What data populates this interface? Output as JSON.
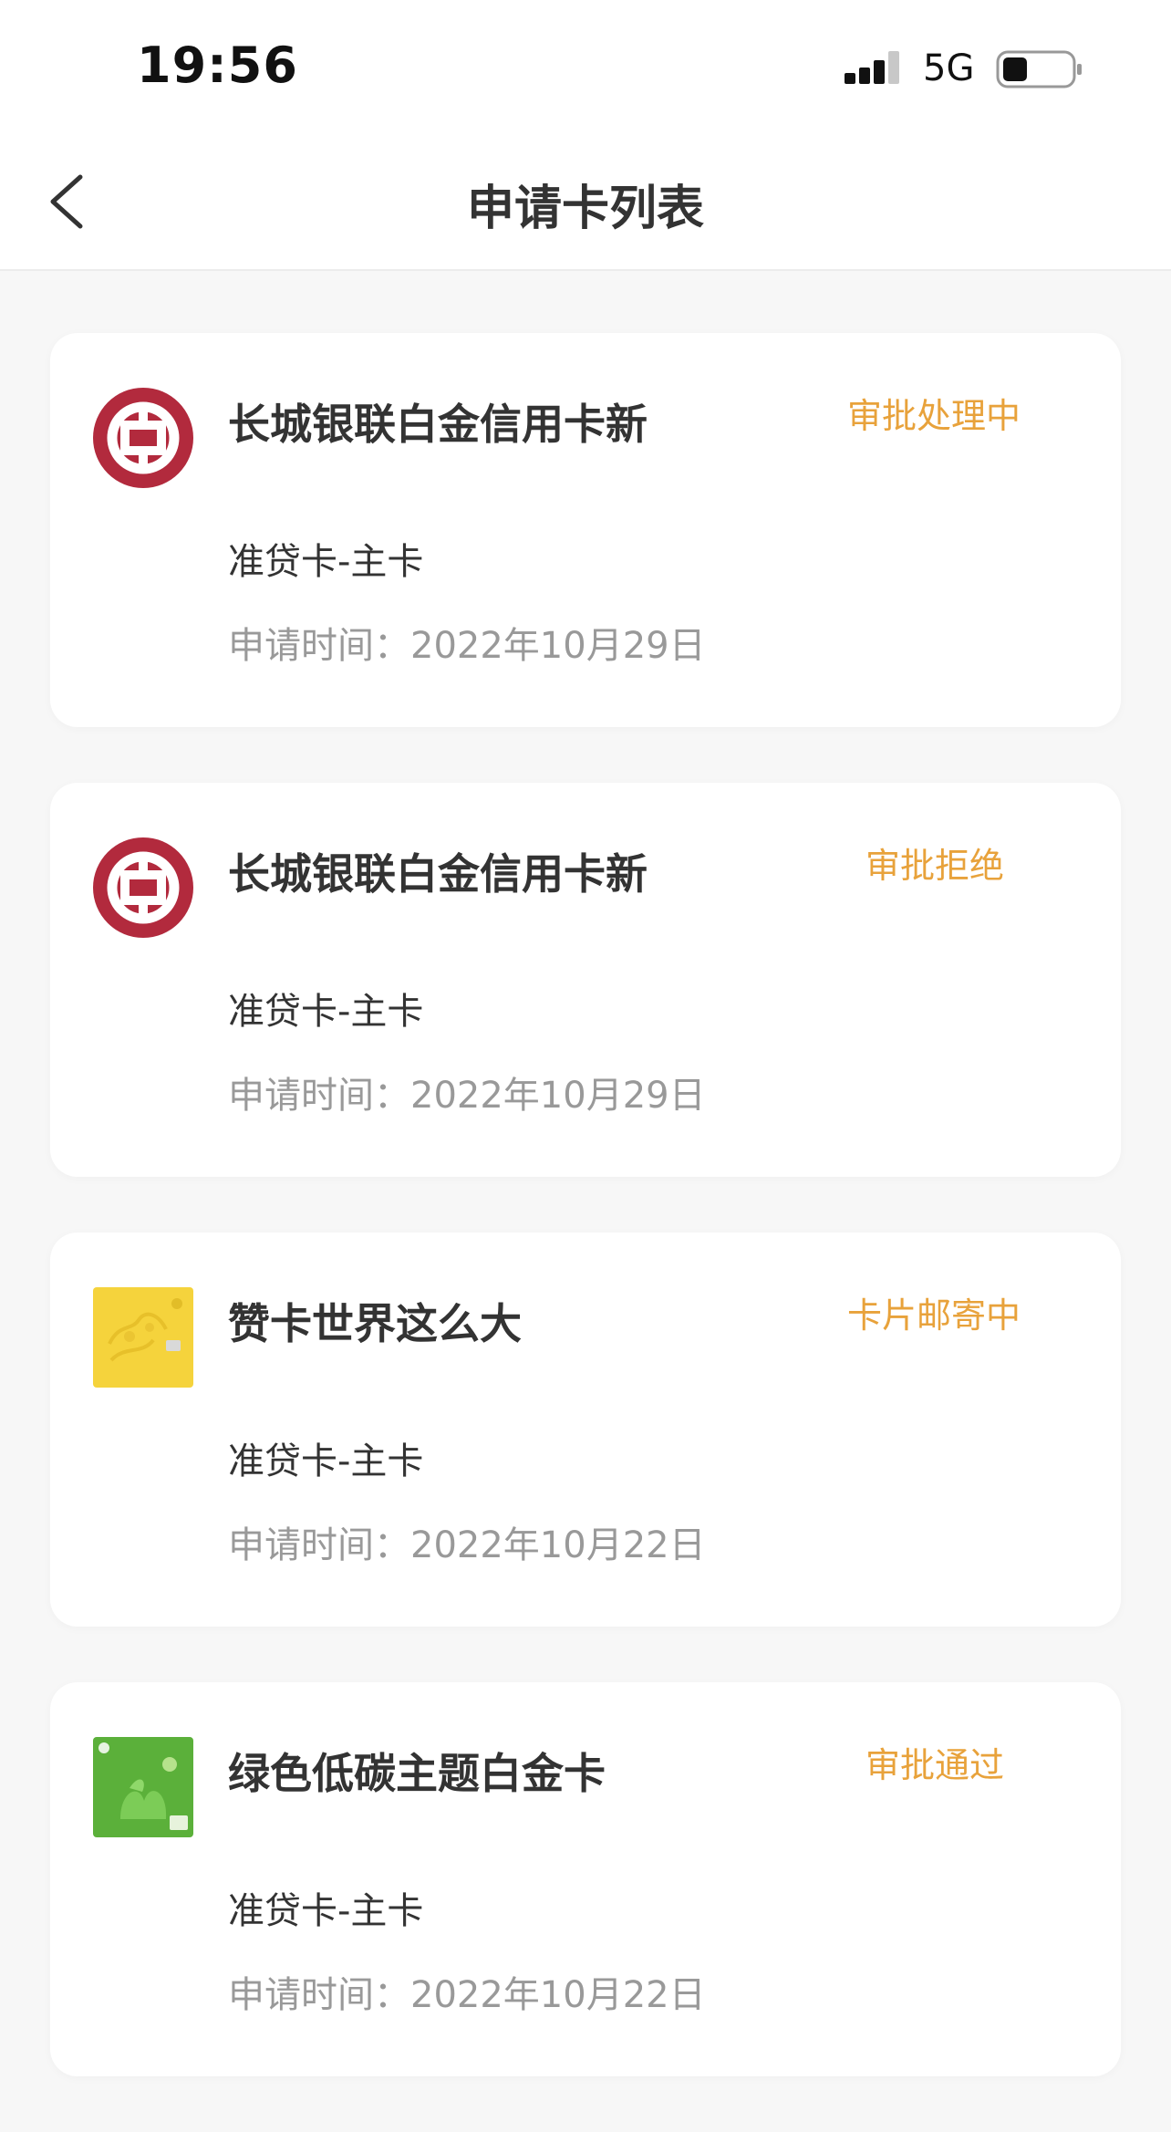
{
  "status_bar": {
    "time": "19:56",
    "network": "5G"
  },
  "nav": {
    "title": "申请卡列表"
  },
  "colors": {
    "status_accent": "#e8a23b",
    "boc_red": "#b22a3d",
    "yellow_card": "#f5d33c",
    "green_card": "#5bb03a"
  },
  "cards": [
    {
      "title": "长城银联白金信用卡新",
      "status": "审批处理中",
      "type": "准贷卡-主卡",
      "date_label": "申请时间：",
      "date": "2022年10月29日",
      "icon": "boc-logo-icon"
    },
    {
      "title": "长城银联白金信用卡新",
      "status": "审批拒绝",
      "type": "准贷卡-主卡",
      "date_label": "申请时间：",
      "date": "2022年10月29日",
      "icon": "boc-logo-icon"
    },
    {
      "title": "赞卡世界这么大",
      "status": "卡片邮寄中",
      "type": "准贷卡-主卡",
      "date_label": "申请时间：",
      "date": "2022年10月22日",
      "icon": "yellow-card-icon"
    },
    {
      "title": "绿色低碳主题白金卡",
      "status": "审批通过",
      "type": "准贷卡-主卡",
      "date_label": "申请时间：",
      "date": "2022年10月22日",
      "icon": "green-card-icon"
    }
  ]
}
